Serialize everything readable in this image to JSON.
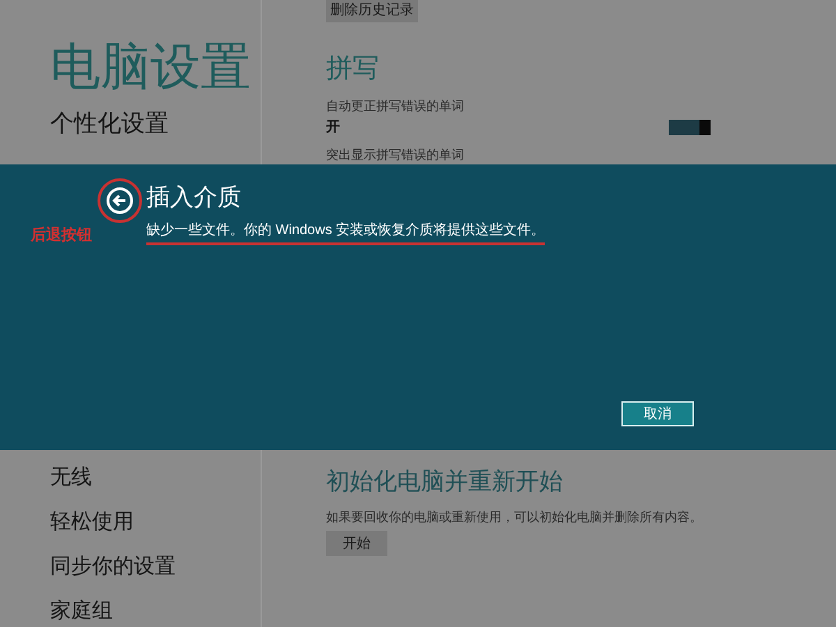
{
  "top_button": "删除历史记录",
  "title": "电脑设置",
  "nav_top": [
    "个性化设置"
  ],
  "spelling": {
    "heading": "拼写",
    "autocorrect_label": "自动更正拼写错误的单词",
    "autocorrect_value": "开",
    "autocorrect_on": true,
    "highlight_label": "突出显示拼写错误的单词"
  },
  "dialog": {
    "annotation": "后退按钮",
    "title": "插入介质",
    "message": "缺少一些文件。你的 Windows 安装或恢复介质将提供这些文件。",
    "cancel": "取消"
  },
  "nav_bottom": [
    "无线",
    "轻松使用",
    "同步你的设置",
    "家庭组"
  ],
  "reset": {
    "heading": "初始化电脑并重新开始",
    "description": "如果要回收你的电脑或重新使用，可以初始化电脑并删除所有内容。",
    "button": "开始"
  }
}
